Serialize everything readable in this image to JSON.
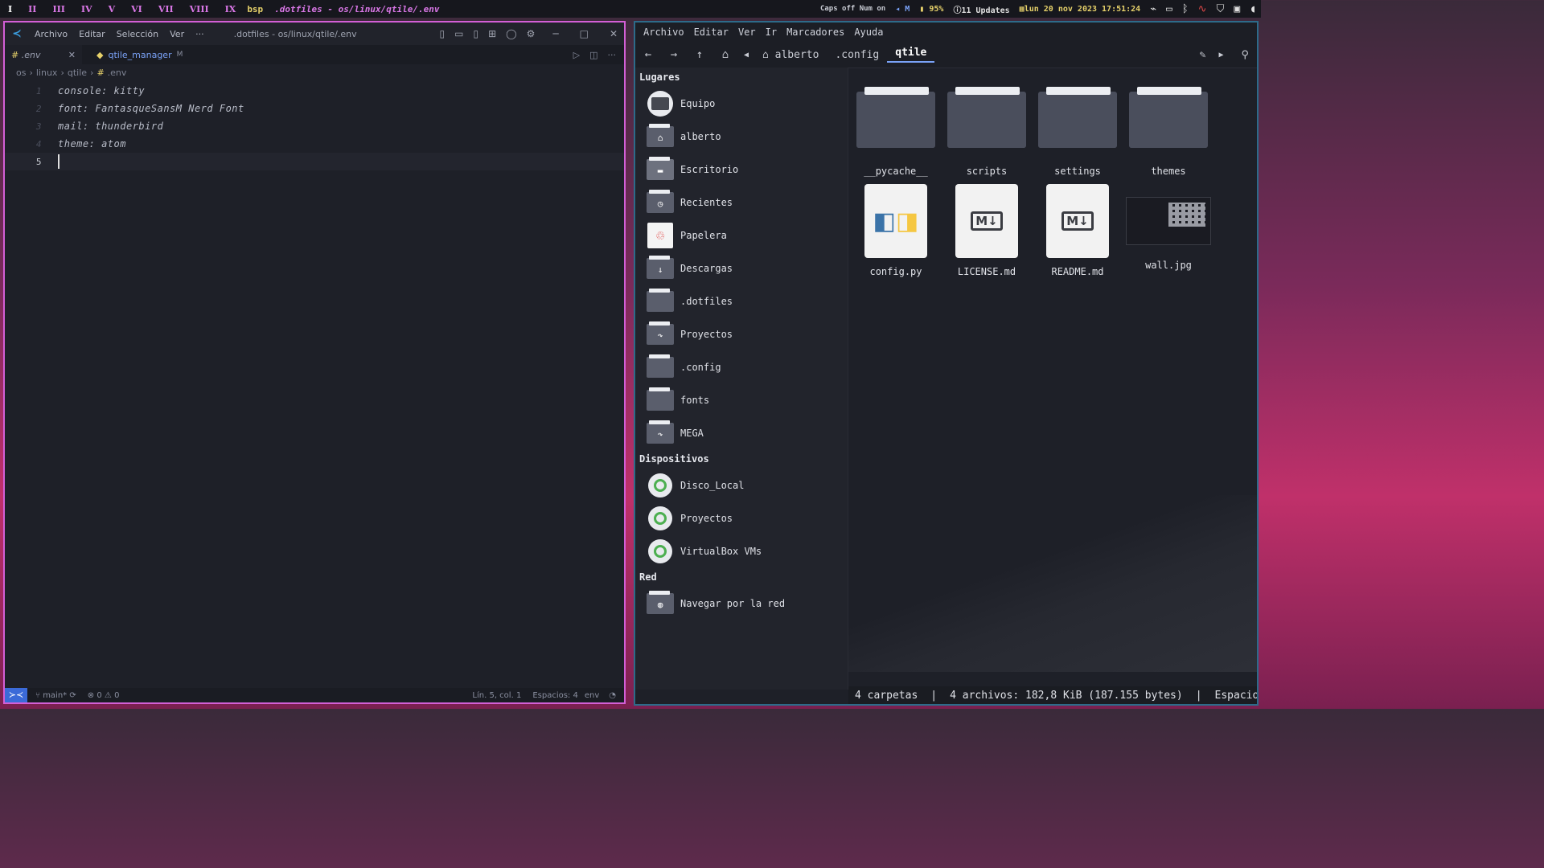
{
  "topbar": {
    "workspaces": [
      "I",
      "II",
      "III",
      "IV",
      "V",
      "VI",
      "VII",
      "VIII",
      "IX"
    ],
    "layout": "bsp",
    "window_title": ".dotfiles - os/linux/qtile/.env",
    "caps": "Caps off Num on",
    "volume": "M",
    "battery": "95%",
    "updates": "11 Updates",
    "datetime": "lun 20 nov 2023 17:51:24"
  },
  "vscode": {
    "menus": [
      "Archivo",
      "Editar",
      "Selección",
      "Ver",
      "···"
    ],
    "title": ".dotfiles - os/linux/qtile/.env",
    "tabs": [
      {
        "label": ".env",
        "close": "✕"
      },
      {
        "label": "qtile_manager",
        "badge": "M"
      }
    ],
    "breadcrumb": [
      "os",
      "linux",
      "qtile",
      ".env"
    ],
    "lines": [
      {
        "n": "1",
        "text": "console: kitty"
      },
      {
        "n": "2",
        "text": "font: FantasqueSansM Nerd Font"
      },
      {
        "n": "3",
        "text": "mail: thunderbird"
      },
      {
        "n": "4",
        "text": "theme: atom"
      },
      {
        "n": "5",
        "text": ""
      }
    ],
    "status": {
      "branch": "main*",
      "errors": "0",
      "warnings": "0",
      "position": "Lín. 5, col. 1",
      "spaces": "Espacios: 4",
      "lang": "env"
    }
  },
  "filemanager": {
    "menus": [
      "Archivo",
      "Editar",
      "Ver",
      "Ir",
      "Marcadores",
      "Ayuda"
    ],
    "path": [
      "alberto",
      ".config",
      "qtile"
    ],
    "sidebar": {
      "places_header": "Lugares",
      "places": [
        {
          "label": "Equipo",
          "icon": "computer-icon"
        },
        {
          "label": "alberto",
          "icon": "home-folder-icon"
        },
        {
          "label": "Escritorio",
          "icon": "desktop-folder-icon"
        },
        {
          "label": "Recientes",
          "icon": "recent-folder-icon"
        },
        {
          "label": "Papelera",
          "icon": "trash-icon"
        },
        {
          "label": "Descargas",
          "icon": "downloads-folder-icon"
        },
        {
          "label": ".dotfiles",
          "icon": "folder-icon"
        },
        {
          "label": "Proyectos",
          "icon": "link-folder-icon"
        },
        {
          "label": ".config",
          "icon": "folder-icon"
        },
        {
          "label": "fonts",
          "icon": "folder-icon"
        },
        {
          "label": "MEGA",
          "icon": "link-folder-icon"
        }
      ],
      "devices_header": "Dispositivos",
      "devices": [
        {
          "label": "Disco_Local"
        },
        {
          "label": "Proyectos"
        },
        {
          "label": "VirtualBox VMs"
        }
      ],
      "network_header": "Red",
      "network": [
        {
          "label": "Navegar por la red"
        }
      ]
    },
    "items": [
      {
        "name": "__pycache__",
        "type": "folder"
      },
      {
        "name": "scripts",
        "type": "folder"
      },
      {
        "name": "settings",
        "type": "folder"
      },
      {
        "name": "themes",
        "type": "folder"
      },
      {
        "name": "config.py",
        "type": "python"
      },
      {
        "name": "LICENSE.md",
        "type": "markdown"
      },
      {
        "name": "README.md",
        "type": "markdown"
      },
      {
        "name": "wall.jpg",
        "type": "image"
      }
    ],
    "status": {
      "folders": "4 carpetas",
      "files": "4 archivos: 182,8 KiB (187.155 bytes)",
      "space": "Espacio ..."
    }
  },
  "colors": {
    "accent": "#d35fd6",
    "vscode_blue": "#3b9dde",
    "fm_border": "#2d6b8a"
  }
}
